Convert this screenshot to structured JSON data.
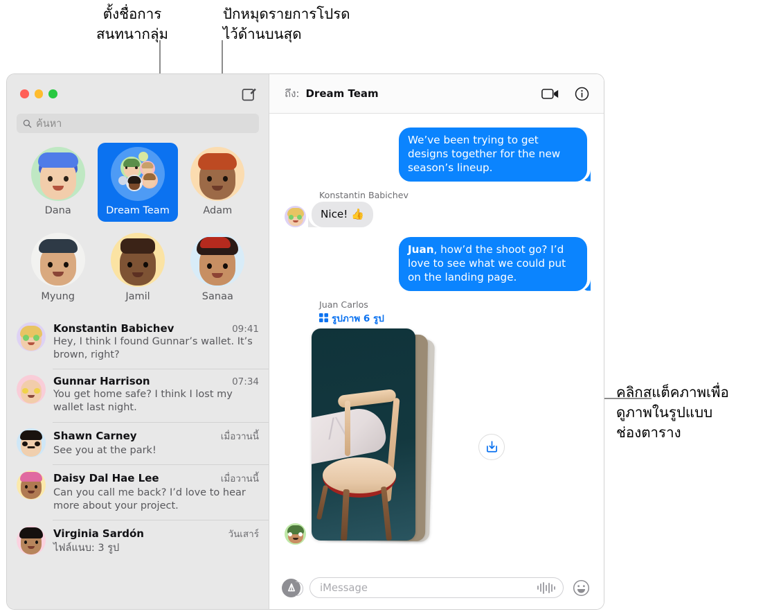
{
  "annotations": {
    "top_left": "ตั้งชื่อการ\nสนทนากลุ่ม",
    "top_right": "ปักหมุดรายการโปรด\nไว้ด้านบนสุด",
    "right": "คลิกสแต็คภาพเพื่อ\nดูภาพในรูปแบบ\nช่องตาราง"
  },
  "window": {
    "traffic_lights": [
      "close",
      "minimize",
      "zoom"
    ],
    "compose_icon": "compose-icon"
  },
  "sidebar": {
    "search": {
      "placeholder": "ค้นหา",
      "icon": "search-icon"
    },
    "pinned": [
      {
        "name": "Dana",
        "selected": false
      },
      {
        "name": "Dream Team",
        "selected": true
      },
      {
        "name": "Adam",
        "selected": false
      },
      {
        "name": "Myung",
        "selected": false
      },
      {
        "name": "Jamil",
        "selected": false
      },
      {
        "name": "Sanaa",
        "selected": false
      }
    ],
    "conversations": [
      {
        "name": "Konstantin Babichev",
        "time": "09:41",
        "preview": "Hey, I think I found Gunnar’s wallet. It’s brown, right?"
      },
      {
        "name": "Gunnar Harrison",
        "time": "07:34",
        "preview": "You get home safe? I think I lost my wallet last night."
      },
      {
        "name": "Shawn Carney",
        "time": "เมื่อวานนี้",
        "preview": "See you at the park!"
      },
      {
        "name": "Daisy Dal Hae Lee",
        "time": "เมื่อวานนี้",
        "preview": "Can you call me back? I’d love to hear more about your project."
      },
      {
        "name": "Virginia Sardón",
        "time": "วันเสาร์",
        "preview": "ไฟล์แนบ:  3 รูป"
      }
    ]
  },
  "chat": {
    "header": {
      "to_label": "ถึง:",
      "to_name": "Dream Team",
      "facetime_icon": "video-camera-icon",
      "info_icon": "info-circle-icon"
    },
    "messages": [
      {
        "direction": "outgoing",
        "text": "We’ve been trying to get designs together for the new season’s lineup."
      },
      {
        "direction": "incoming",
        "sender": "Konstantin Babichev",
        "text": "Nice!  👍"
      },
      {
        "direction": "outgoing",
        "text_bold": "Juan",
        "text": ", how’d the shoot go? I’d love to see what we could put on the landing page."
      },
      {
        "direction": "incoming",
        "sender": "Juan Carlos",
        "attachment_icon": "grid-icon",
        "attachment_label": "รูปภาพ 6 รูป",
        "attachment_type": "photo-stack"
      }
    ],
    "save_button_icon": "download-icon",
    "input": {
      "apps_icon": "app-store-icon",
      "placeholder": "iMessage",
      "audio_icon": "audio-waveform-icon",
      "emoji_icon": "emoji-smiley-icon"
    }
  },
  "colors": {
    "accent_blue": "#0b84fe",
    "pin_selected": "#0b72f0",
    "sidebar_bg": "#e8e8e8",
    "bubble_gray": "#e6e6e8",
    "link_blue": "#0b72f0"
  }
}
